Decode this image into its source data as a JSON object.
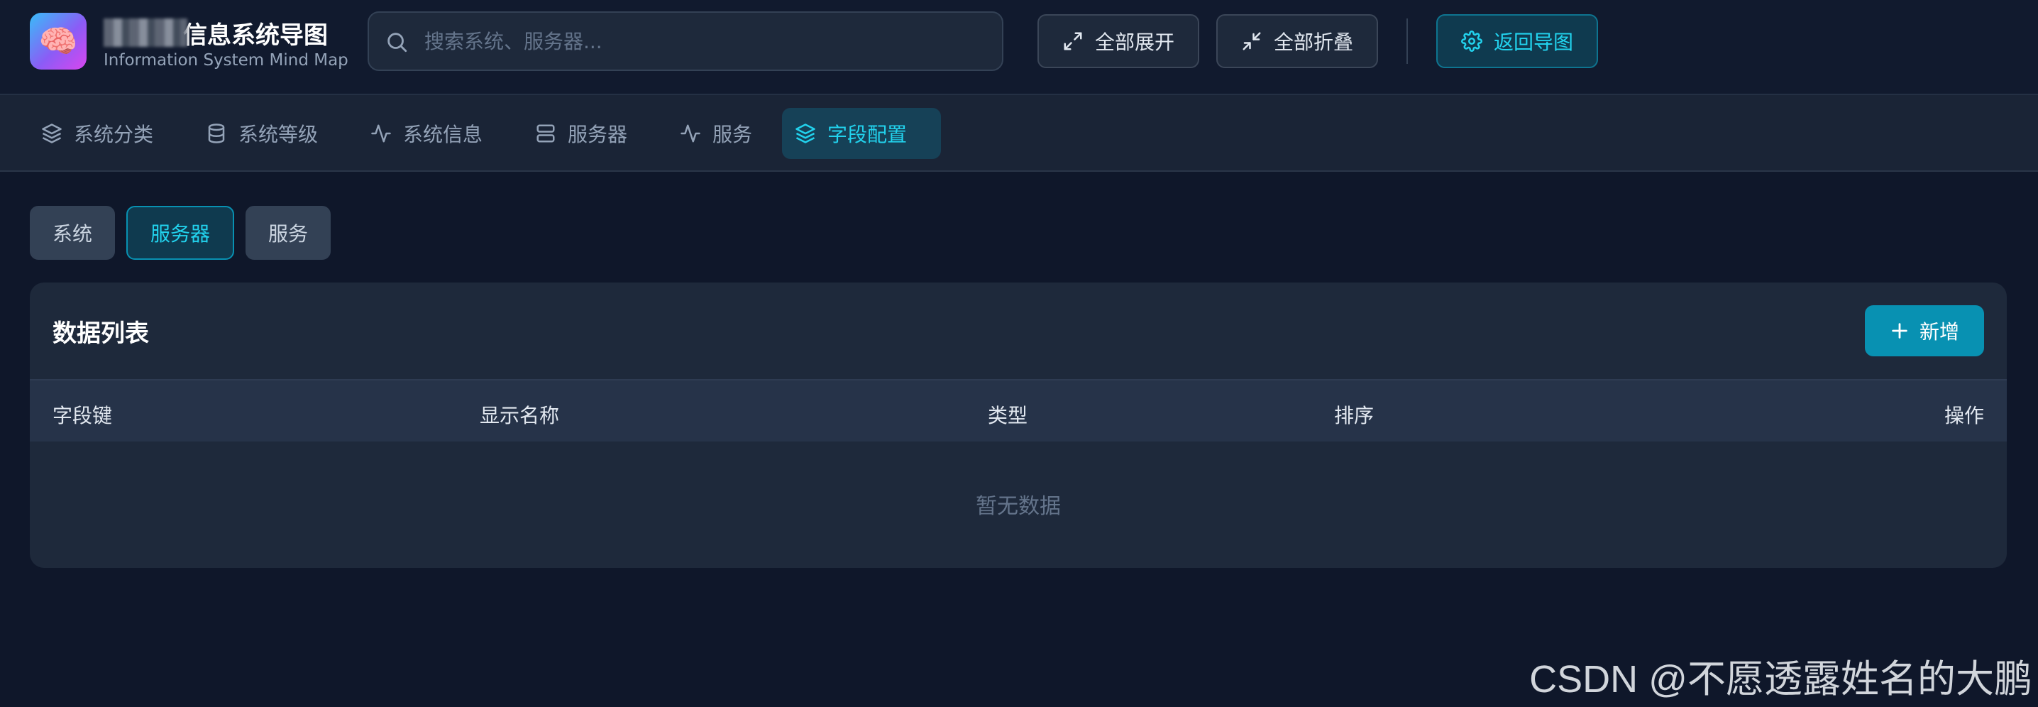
{
  "header": {
    "logo_emoji": "🧠",
    "title": "信息系统导图",
    "subtitle": "Information System Mind Map",
    "search": {
      "placeholder": "搜索系统、服务器..."
    },
    "expand_all_label": "全部展开",
    "collapse_all_label": "全部折叠",
    "back_label": "返回导图"
  },
  "nav": {
    "tabs": [
      {
        "label": "系统分类",
        "icon": "layers-icon",
        "active": false
      },
      {
        "label": "系统等级",
        "icon": "database-icon",
        "active": false
      },
      {
        "label": "系统信息",
        "icon": "activity-icon",
        "active": false
      },
      {
        "label": "服务器",
        "icon": "server-icon",
        "active": false
      },
      {
        "label": "服务",
        "icon": "activity-icon",
        "active": false
      },
      {
        "label": "字段配置",
        "icon": "layers-icon",
        "active": true
      }
    ]
  },
  "subtabs": [
    {
      "label": "系统",
      "active": false
    },
    {
      "label": "服务器",
      "active": true
    },
    {
      "label": "服务",
      "active": false
    }
  ],
  "table_card": {
    "title": "数据列表",
    "add_label": "新增",
    "columns": [
      "字段键",
      "显示名称",
      "类型",
      "排序",
      "操作"
    ],
    "empty_text": "暂无数据"
  },
  "watermark": "CSDN @不愿透露姓名的大鹏",
  "colors": {
    "background": "#0f172a",
    "accent": "#22d3ee",
    "primary_button": "#0891b2"
  }
}
